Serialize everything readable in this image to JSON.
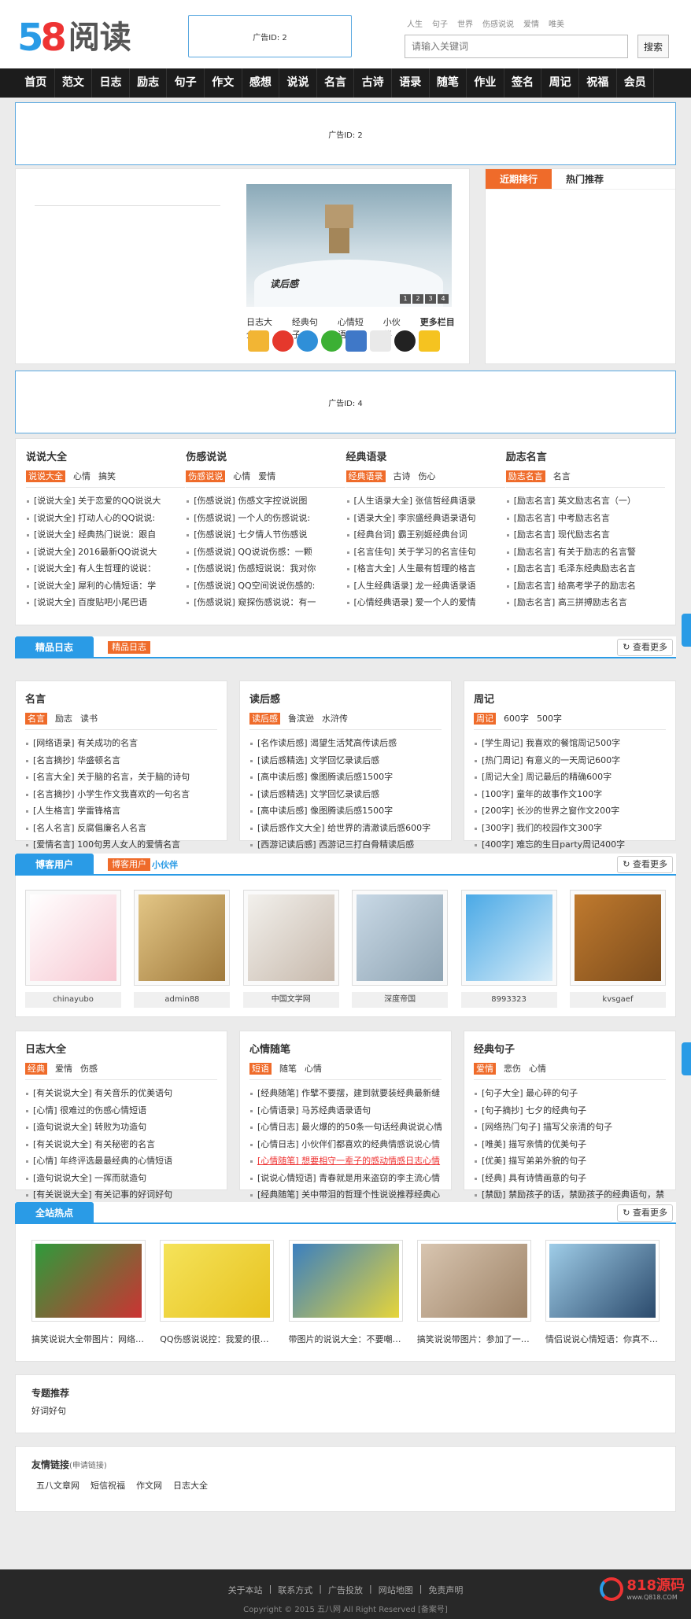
{
  "header": {
    "logo_num": "58",
    "logo_text": "阅读",
    "ad": "广告ID: 2",
    "hot_words": [
      "人生",
      "句子",
      "世界",
      "伤感说说",
      "爱情",
      "唯美"
    ],
    "search_placeholder": "请输入关键词",
    "search_button": "搜索"
  },
  "nav": [
    "首页",
    "范文",
    "日志",
    "励志",
    "句子",
    "作文",
    "感想",
    "说说",
    "名言",
    "古诗",
    "语录",
    "随笔",
    "作业",
    "签名",
    "周记",
    "祝福",
    "会员"
  ],
  "ad_banner_1": "广告ID: 2",
  "ad_banner_2": "广告ID: 4",
  "slide": {
    "caption": "读后感",
    "dots": [
      "1",
      "2",
      "3",
      "4"
    ],
    "links": [
      "日志大全",
      "经典句子",
      "心情短语",
      "小伙伴",
      "更多栏目>>"
    ]
  },
  "rank": {
    "tab_active": "近期排行",
    "tab_other": "热门推荐"
  },
  "cat_block_1": [
    {
      "title": "说说大全",
      "tabs": [
        "说说大全",
        "心情",
        "搞笑"
      ],
      "items": [
        "[说说大全] 关于恋爱的QQ说说大",
        "[说说大全] 打动人心的QQ说说:",
        "[说说大全] 经典热门说说：跟自",
        "[说说大全] 2016最新QQ说说大",
        "[说说大全] 有人生哲理的说说：",
        "[说说大全] 犀利的心情短语：学",
        "[说说大全] 百度贴吧小尾巴语"
      ]
    },
    {
      "title": "伤感说说",
      "tabs": [
        "伤感说说",
        "心情",
        "爱情"
      ],
      "items": [
        "[伤感说说] 伤感文字控说说图",
        "[伤感说说] 一个人的伤感说说:",
        "[伤感说说] 七夕情人节伤感说",
        "[伤感说说] QQ说说伤感：一颗",
        "[伤感说说] 伤感短说说：我对你",
        "[伤感说说] QQ空间说说伤感的:",
        "[伤感说说] 窥探伤感说说：有一"
      ]
    },
    {
      "title": "经典语录",
      "tabs": [
        "经典语录",
        "古诗",
        "伤心"
      ],
      "items": [
        "[人生语录大全] 张信哲经典语录",
        "[语录大全] 李宗盛经典语录语句",
        "[经典台词] 霸王别姬经典台词",
        "[名言佳句] 关于学习的名言佳句",
        "[格言大全] 人生最有哲理的格言",
        "[人生经典语录] 龙一经典语录语",
        "[心情经典语录] 爱一个人的爱情"
      ]
    },
    {
      "title": "励志名言",
      "tabs": [
        "励志名言",
        "名言"
      ],
      "items": [
        "[励志名言] 英文励志名言（一）",
        "[励志名言] 中考励志名言",
        "[励志名言] 现代励志名言",
        "[励志名言] 有关于励志的名言警",
        "[励志名言] 毛泽东经典励志名言",
        "[励志名言] 给高考学子的励志名",
        "[励志名言] 高三拼搏励志名言"
      ]
    }
  ],
  "section_diary": {
    "title": "精品日志",
    "tag": "精品日志",
    "more": "查看更多"
  },
  "cat_block_2": [
    {
      "title": "名言",
      "tabs": [
        "名言",
        "励志",
        "读书"
      ],
      "items": [
        "[网络语录] 有关成功的名言",
        "[名言摘抄] 华盛顿名言",
        "[名言大全] 关于脑的名言，关于脑的诗句",
        "[名言摘抄] 小学生作文我喜欢的一句名言",
        "[人生格言] 学雷锋格言",
        "[名人名言] 反腐倡廉名人名言",
        "[爱情名言] 100句男人女人的爱情名言"
      ]
    },
    {
      "title": "读后感",
      "tabs": [
        "读后感",
        "鲁滨逊",
        "水浒传"
      ],
      "items": [
        "[名作读后感] 渴望生活梵高传读后感",
        "[读后感精选] 文学回忆录读后感",
        "[高中读后感] 像图腾读后感1500字",
        "[读后感精选] 文学回忆录读后感",
        "[高中读后感] 像图腾读后感1500字",
        "[读后感作文大全] 给世界的清澈读后感600字",
        "[西游记读后感] 西游记三打白骨精读后感"
      ]
    },
    {
      "title": "周记",
      "tabs": [
        "周记",
        "600字",
        "500字"
      ],
      "items": [
        "[学生周记] 我喜欢的餐馆周记500字",
        "[热门周记] 有意义的一天周记600字",
        "[周记大全] 周记最后的精确600字",
        "[100字] 童年的故事作文100字",
        "[200字] 长沙的世界之窗作文200字",
        "[300字] 我们的校园作文300字",
        "[400字] 难忘的生日party周记400字"
      ]
    }
  ],
  "section_users": {
    "title": "博客用户",
    "tag": "博客用户",
    "tag2": "小伙伴",
    "more": "查看更多"
  },
  "users": [
    {
      "name": "chinayubo"
    },
    {
      "name": "admin88"
    },
    {
      "name": "中国文学网"
    },
    {
      "name": "深度帝国"
    },
    {
      "name": "8993323"
    },
    {
      "name": "kvsgaef"
    }
  ],
  "cat_block_3": [
    {
      "title": "日志大全",
      "tabs": [
        "经典",
        "爱情",
        "伤感"
      ],
      "items": [
        "[有关说说大全] 有关音乐的优美语句",
        "[心情] 很难过的伤感心情短语",
        "[造句说说大全] 转败为功造句",
        "[有关说说大全] 有关秘密的名言",
        "[心情] 年终评选最最经典的心情短语",
        "[造句说说大全] 一挥而就造句",
        "[有关说说大全] 有关记事的好词好句"
      ]
    },
    {
      "title": "心情随笔",
      "tabs": [
        "短语",
        "随笔",
        "心情"
      ],
      "items": [
        "[经典随笔] 作擘不要摆，建到就要装经典最新缝",
        "[心情语录] 马苏经典语录语句",
        "[心情日志] 最火爆的的50条一句话经典说说心情经",
        "[心情日志] 小伙伴们都喜欢的经典情感说说心情",
        "[心情随笔] 想要相守一辈子的感动情感日志心情",
        "[说说心情短语] 青春就是用来盗窃的李主流心情",
        "[经典随笔] 关中带泪的哲理个性说说推荐经典心"
      ]
    },
    {
      "title": "经典句子",
      "tabs": [
        "爱情",
        "悲伤",
        "心情"
      ],
      "items": [
        "[句子大全] 最心碎的句子",
        "[句子摘抄] 七夕的经典句子",
        "[网络热门句子] 描写父亲清的句子",
        "[唯美] 描写亲情的优美句子",
        "[优美] 描写弟弟外貌的句子",
        "[经典] 具有诗情画意的句子",
        "[禁励] 禁励孩子的话，禁励孩子的经典语句，禁"
      ]
    }
  ],
  "section_hot": {
    "title": "全站热点",
    "more": "查看更多"
  },
  "hot_items": [
    {
      "caption": "搞笑说说大全带图片：网络…"
    },
    {
      "caption": "QQ伤感说说控：我爱的很小…"
    },
    {
      "caption": "带图片的说说大全：不要嘲…"
    },
    {
      "caption": "搞笑说说带图片：参加了一…"
    },
    {
      "caption": "情侣说说心情短语：你真不…"
    }
  ],
  "topics": {
    "title": "专题推荐",
    "items": [
      "好词好句"
    ]
  },
  "links": {
    "title": "友情链接",
    "sub": "(申请链接)",
    "items": [
      "五八文章网",
      "短信祝福",
      "作文网",
      "日志大全"
    ]
  },
  "footer": {
    "links": [
      "关于本站",
      "联系方式",
      "广告投放",
      "网站地图",
      "免责声明"
    ],
    "copyright": "Copyright © 2015 五八网 All Right Reserved [备案号]",
    "badge": "818源码",
    "badge_url": "www.Q818.COM"
  }
}
